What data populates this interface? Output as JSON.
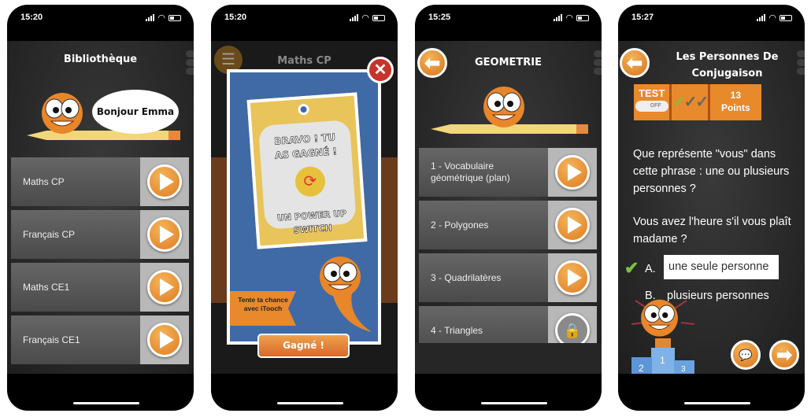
{
  "screens": [
    {
      "time": "15:20",
      "title": "Bibliothèque",
      "greeting": "Bonjour Emma",
      "items": [
        {
          "label": "Maths CP"
        },
        {
          "label": "Français CP"
        },
        {
          "label": "Maths CE1"
        },
        {
          "label": "Français CE1"
        }
      ]
    },
    {
      "time": "15:20",
      "title": "Maths CP",
      "popup": {
        "headline": "BRAVO ! TU AS GAGNÉ !",
        "prize": "UN POWER UP SWITCH",
        "promo": "Tente ta chance avec iTooch",
        "button": "Gagné !"
      }
    },
    {
      "time": "15:25",
      "title": "GEOMETRIE",
      "items": [
        {
          "label": "1 - Vocabulaire géométrique (plan)",
          "locked": false
        },
        {
          "label": "2 - Polygones",
          "locked": false
        },
        {
          "label": "3 - Quadrilatères",
          "locked": false
        },
        {
          "label": "4 - Triangles",
          "locked": true
        }
      ]
    },
    {
      "time": "15:27",
      "title": "Les Personnes De Conjugaison",
      "test_label": "TEST",
      "toggle": "OFF",
      "checks": "✓✓✓",
      "points": "13 Points",
      "question": "Que représente \"vous\" dans cette phrase : une ou plusieurs personnes ?",
      "sentence": "Vous avez l'heure s'il vous plaît madame ?",
      "answers": [
        {
          "letter": "A.",
          "text": "une seule personne",
          "selected": true
        },
        {
          "letter": "B.",
          "text": "plusieurs personnes",
          "selected": false
        }
      ],
      "podium": [
        "1",
        "2",
        "3"
      ]
    }
  ],
  "colors": {
    "accent": "#e8892c",
    "popup_blue": "#3f6aa6",
    "correct": "#7cc242"
  }
}
